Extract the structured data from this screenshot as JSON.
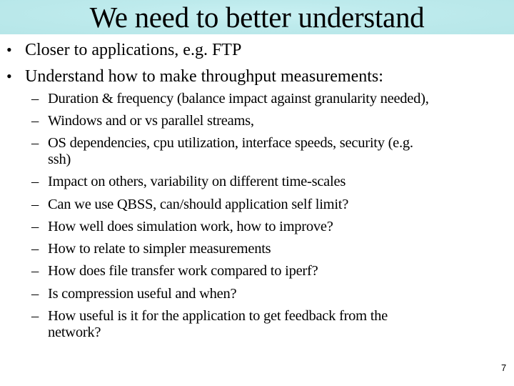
{
  "slide": {
    "title": "We need to better understand",
    "title_bar_color": "#b9e8ea",
    "bullets": [
      {
        "marker": "•",
        "text": "Closer to applications, e.g. FTP"
      },
      {
        "marker": "•",
        "text": "Understand how to make throughput measurements:"
      }
    ],
    "sub_bullets": [
      {
        "marker": "–",
        "lines": [
          "Duration & frequency (balance impact against granularity needed),"
        ]
      },
      {
        "marker": "–",
        "lines": [
          "Windows and or vs parallel streams,"
        ]
      },
      {
        "marker": "–",
        "lines": [
          "OS dependencies, cpu utilization, interface speeds, security (e.g.",
          "ssh)"
        ]
      },
      {
        "marker": "–",
        "lines": [
          "Impact on others, variability on different time-scales"
        ]
      },
      {
        "marker": "–",
        "lines": [
          "Can we use QBSS, can/should application self limit?"
        ]
      },
      {
        "marker": "–",
        "lines": [
          "How well does simulation work, how to improve?"
        ]
      },
      {
        "marker": "–",
        "lines": [
          "How to relate to simpler measurements"
        ]
      },
      {
        "marker": "–",
        "lines": [
          "How does file transfer work compared to iperf?"
        ]
      },
      {
        "marker": "–",
        "lines": [
          "Is compression useful and when?"
        ]
      },
      {
        "marker": "–",
        "lines": [
          "How useful is it for the application to get feedback from the",
          "network?"
        ]
      }
    ],
    "page_number": "7"
  }
}
